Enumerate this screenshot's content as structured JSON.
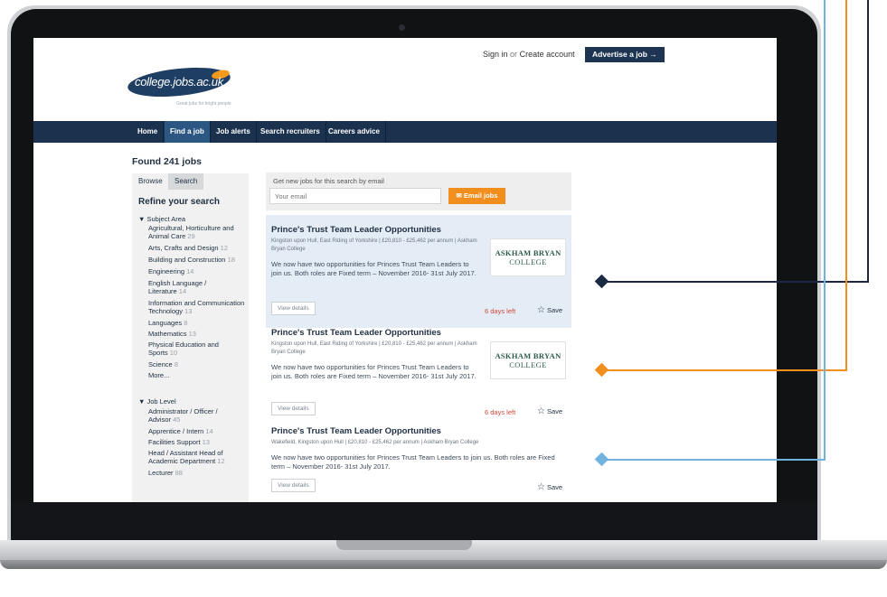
{
  "header": {
    "sign_in": "Sign in",
    "or": "or",
    "create_account": "Create account",
    "advertise_button": "Advertise a job →",
    "logo_text": "college.jobs.ac.uk",
    "tagline": "Great jobs for bright people"
  },
  "nav": {
    "items": [
      {
        "label": "Home",
        "active": false
      },
      {
        "label": "Find a job",
        "active": true
      },
      {
        "label": "Job alerts",
        "active": false
      },
      {
        "label": "Search recruiters",
        "active": false
      },
      {
        "label": "Careers advice",
        "active": false
      }
    ]
  },
  "results": {
    "found": "Found 241 jobs"
  },
  "sidebar": {
    "tabs": [
      "Browse",
      "Search"
    ],
    "refine_title": "Refine your search",
    "subject_area": {
      "title": "▼ Subject Area",
      "items": [
        {
          "label": "Agricultural, Horticulture and Animal Care",
          "count": "29"
        },
        {
          "label": "Arts, Crafts and Design",
          "count": "12"
        },
        {
          "label": "Building and Construction",
          "count": "18"
        },
        {
          "label": "Engineering",
          "count": "14"
        },
        {
          "label": "English Language / Literature",
          "count": "14"
        },
        {
          "label": "Information and Communication Technology",
          "count": "13"
        },
        {
          "label": "Languages",
          "count": "8"
        },
        {
          "label": "Mathematics",
          "count": "13"
        },
        {
          "label": "Physical Education and Sports",
          "count": "10"
        },
        {
          "label": "Science",
          "count": "8"
        }
      ],
      "more": "More..."
    },
    "job_level": {
      "title": "▼ Job Level",
      "items": [
        {
          "label": "Administrator / Officer / Advisor",
          "count": "45"
        },
        {
          "label": "Apprentice / Intern",
          "count": "14"
        },
        {
          "label": "Facilities Support",
          "count": "13"
        },
        {
          "label": "Head / Assistant Head of Academic Department",
          "count": "12"
        },
        {
          "label": "Lecturer",
          "count": "88"
        }
      ]
    }
  },
  "email_alert": {
    "title": "Get new jobs for this search by email",
    "placeholder": "Your email",
    "button": "✉ Email jobs"
  },
  "jobs": [
    {
      "title": "Prince's Trust Team Leader Opportunities",
      "meta": "Kingston upon Hull, East Riding of Yorkshire  |  £20,810 - £25,462 per annum  |  Askham Bryan College",
      "description": "We now have two opportunities for Princes Trust Team Leaders to join us. Both roles are Fixed term – November 2016- 31st July 2017.",
      "view": "View details",
      "days_left": "6 days left",
      "save": "Save",
      "logo_line1": "ASKHAM BRYAN",
      "logo_line2": "COLLEGE"
    },
    {
      "title": "Prince's Trust Team Leader Opportunities",
      "meta": "Kingston upon Hull, East Riding of Yorkshire  |  £20,810 - £25,462 per annum  |  Askham Bryan College",
      "description": "We now have two opportunities for Princes Trust Team Leaders to join us. Both roles are Fixed term – November 2016- 31st July 2017.",
      "view": "View details",
      "days_left": "6 days left",
      "save": "Save",
      "logo_line1": "ASKHAM BRYAN",
      "logo_line2": "COLLEGE"
    },
    {
      "title": "Prince's Trust Team Leader Opportunities",
      "meta": "Wakefield, Kingston upon Hull  |  £20,810 - £25,462 per annum  |  Askham Bryan College",
      "description": "We now have two opportunities for Princes Trust Team Leaders to join us. Both roles are Fixed term – November 2016- 31st July 2017.",
      "view": "View details",
      "save": "Save"
    }
  ],
  "callouts": [
    {
      "color": "#1b2a44"
    },
    {
      "color": "#f18e1d"
    },
    {
      "color": "#6fb3de"
    }
  ]
}
